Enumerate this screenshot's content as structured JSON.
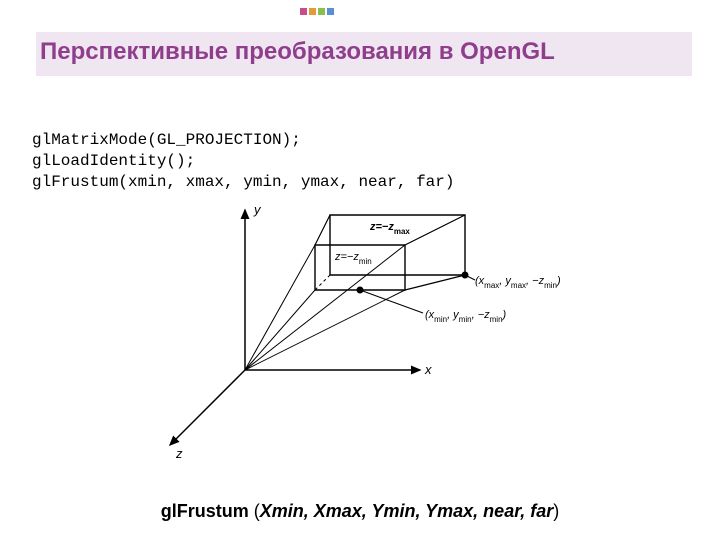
{
  "slide": {
    "title": "Перспективные преобразования в OpenGL",
    "code_line1": "glMatrixMode(GL_PROJECTION);",
    "code_line2": "glLoadIdentity();",
    "code_line3": "glFrustum(xmin, xmax, ymin, ymax, near, far)"
  },
  "caption": {
    "fn": "glFrustum",
    "open": " (",
    "args": "Xmin, Xmax, Ymin, Ymax, near, far",
    "close": ")"
  },
  "diagram": {
    "axis_x": "x",
    "axis_y": "y",
    "axis_z": "z",
    "z_far": "z=−z",
    "z_far_sub": "max",
    "z_near": "z=−z",
    "z_near_sub": "min",
    "pt_far": "(x",
    "pt_far2": ", y",
    "pt_far3": ", −z",
    "pt_far4": ")",
    "pt_far_sub1": "max",
    "pt_far_sub2": "max",
    "pt_far_sub3": "min",
    "pt_near": "(x",
    "pt_near2": ", y",
    "pt_near3": ", −z",
    "pt_near4": ")",
    "pt_near_sub1": "min",
    "pt_near_sub2": "min",
    "pt_near_sub3": "min"
  },
  "logo_colors": [
    "#c94b8c",
    "#e49a3a",
    "#8bbf4c",
    "#5a8fd8"
  ]
}
